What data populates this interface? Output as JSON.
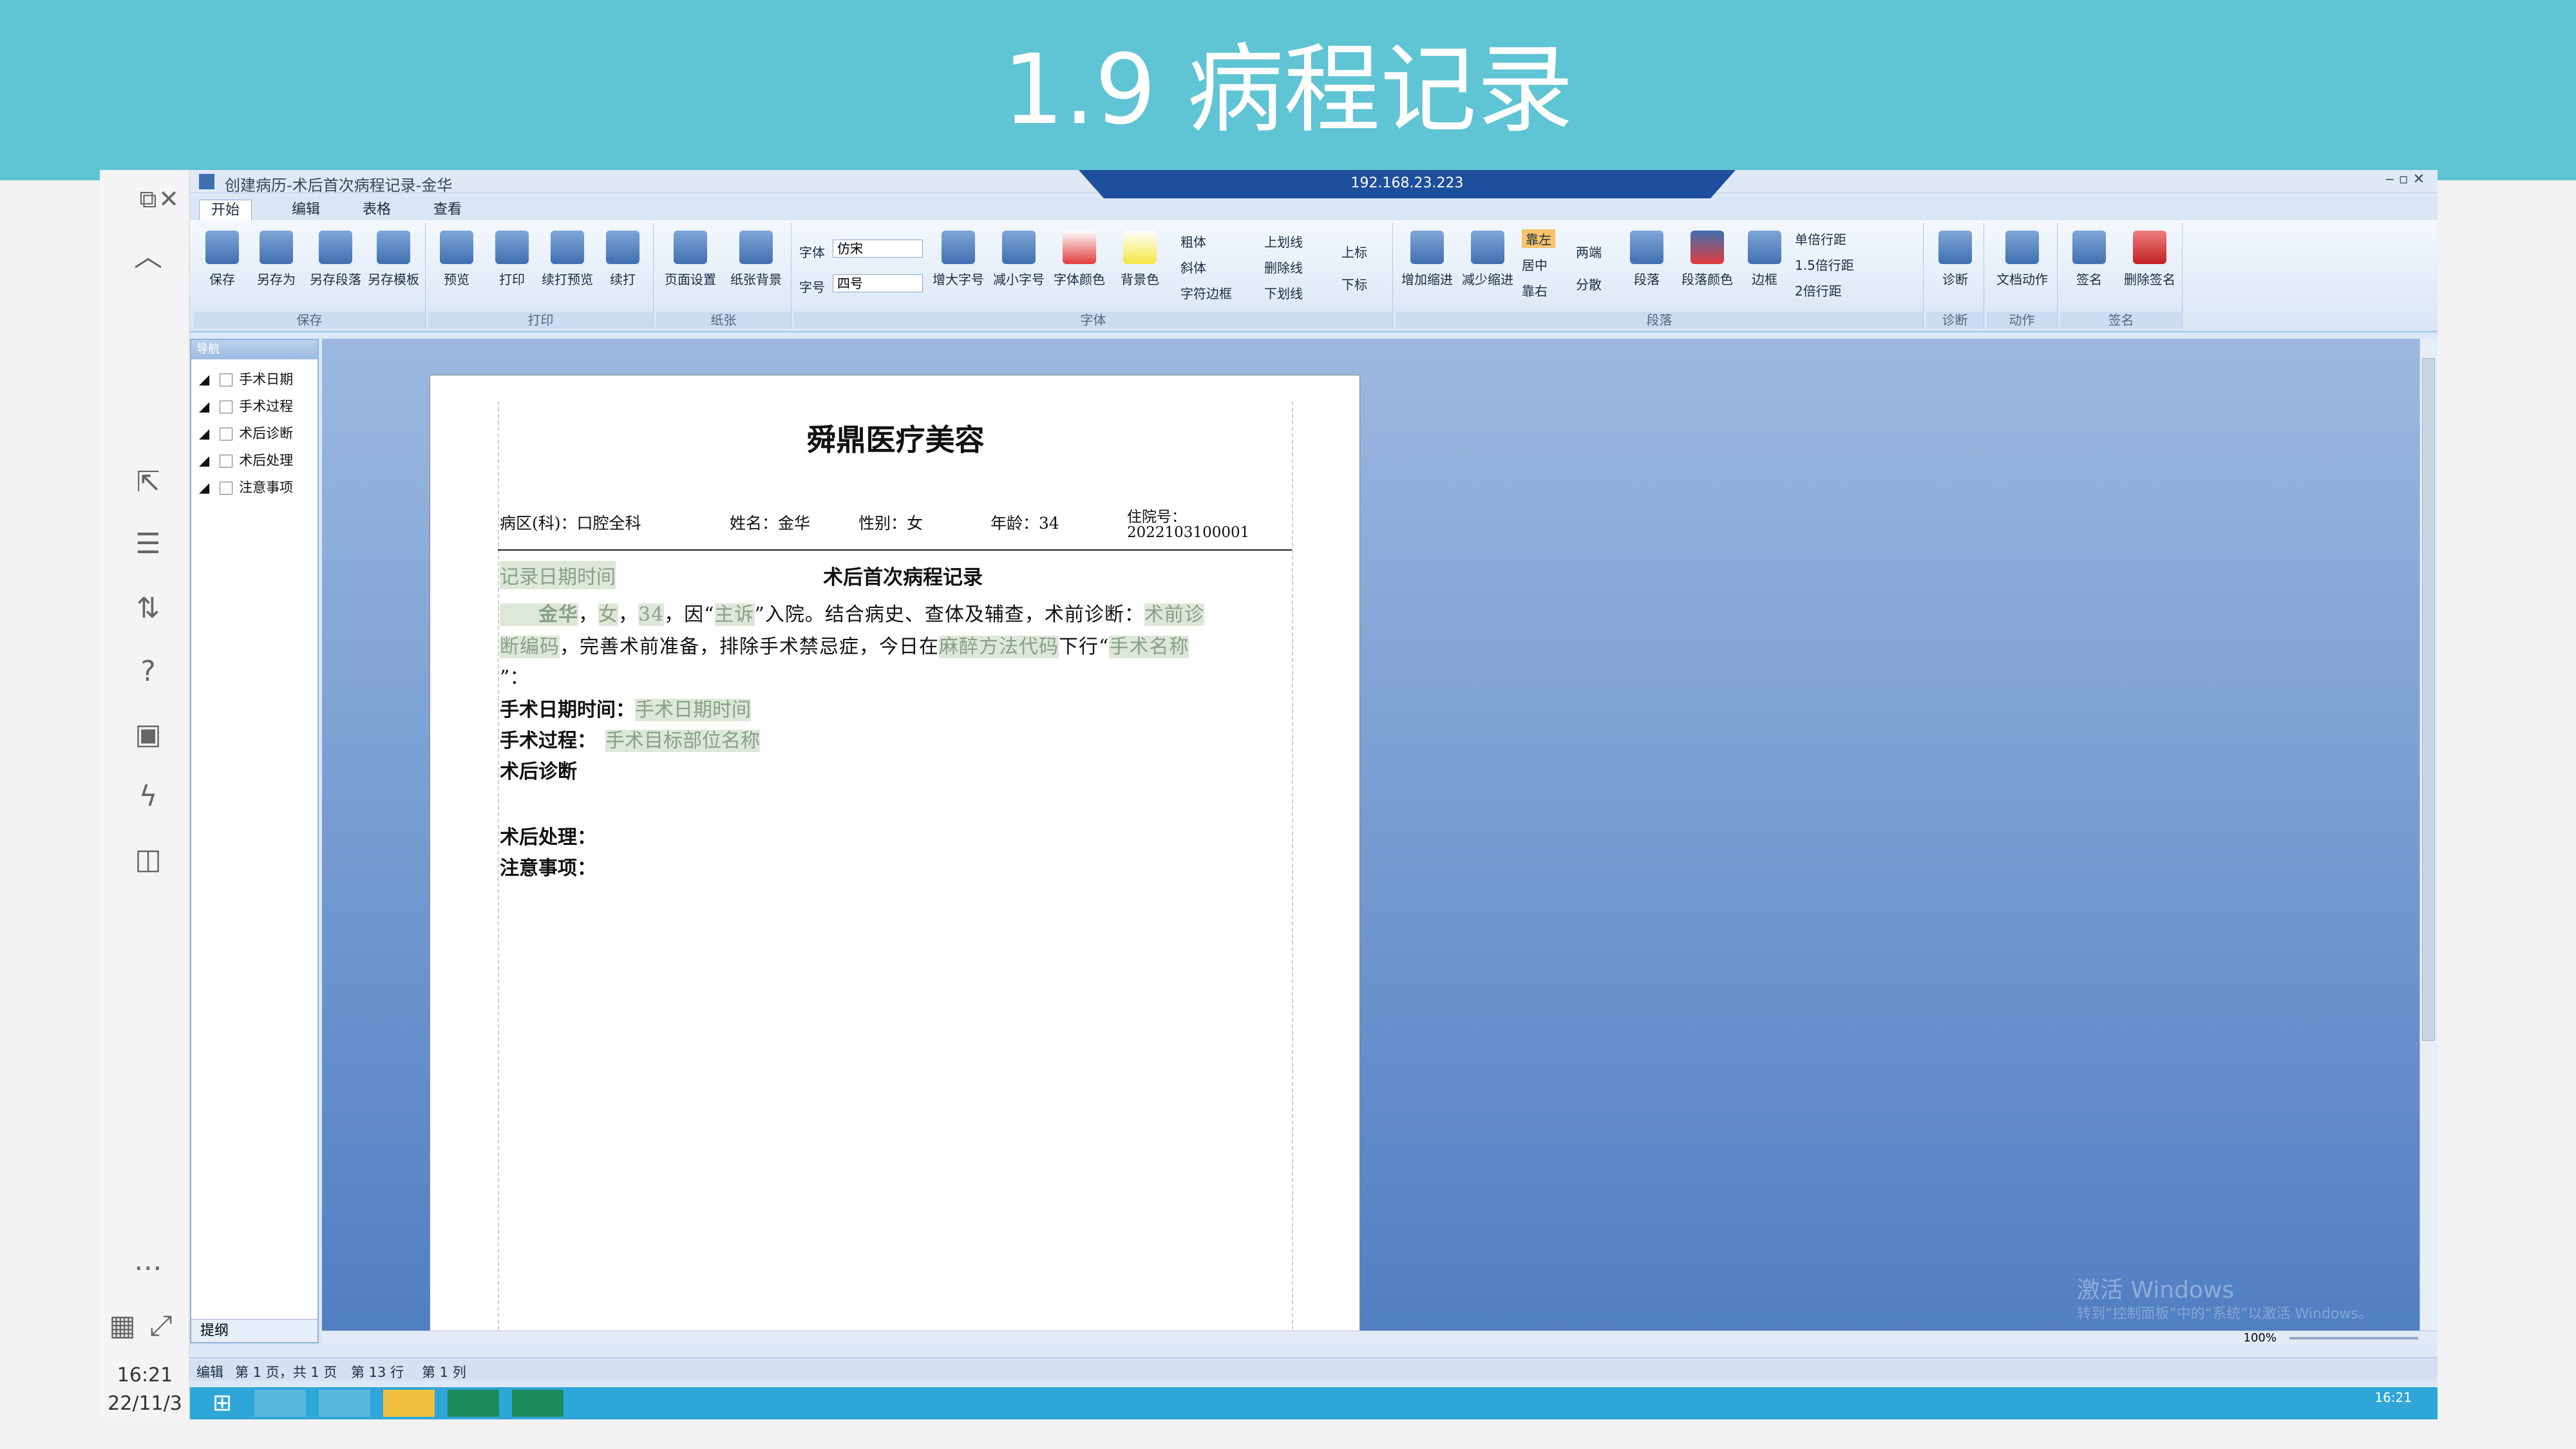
{
  "slide": {
    "title": "1.9 病程记录"
  },
  "window": {
    "title": "创建病历-术后首次病程记录-金华",
    "remote_ip": "192.168.23.223"
  },
  "ribbon_tabs": [
    "开始",
    "编辑",
    "表格",
    "查看"
  ],
  "ribbon": {
    "save_group": {
      "label": "保存",
      "buttons": [
        "保存",
        "另存为",
        "另存段落",
        "另存模板"
      ]
    },
    "print_group": {
      "label": "打印",
      "buttons": [
        "预览",
        "打印",
        "续打预览",
        "续打"
      ]
    },
    "paper_group": {
      "label": "纸张",
      "buttons": [
        "页面设置",
        "纸张背景"
      ]
    },
    "font_group": {
      "label": "字体",
      "font_label": "字体",
      "font_value": "仿宋",
      "size_label": "字号",
      "size_value": "四号",
      "buttons": [
        "增大字号",
        "减小字号",
        "字体颜色",
        "背景色"
      ],
      "styles": [
        "粗体",
        "斜体",
        "字符边框",
        "上划线",
        "删除线",
        "下划线",
        "上标",
        "下标"
      ]
    },
    "para_group": {
      "label": "段落",
      "buttons": [
        "增加缩进",
        "减少缩进",
        "段落",
        "段落颜色",
        "边框"
      ],
      "align": [
        "靠左",
        "居中",
        "靠右",
        "两端",
        "分散"
      ],
      "spacing": [
        "单倍行距",
        "1.5倍行距",
        "2倍行距"
      ]
    },
    "diag_group": {
      "label": "诊断",
      "button": "诊断"
    },
    "action_group": {
      "label": "动作",
      "button": "文档动作"
    },
    "sign_group": {
      "label": "签名",
      "buttons": [
        "签名",
        "删除签名"
      ]
    }
  },
  "nav": {
    "header": "导航",
    "items": [
      "手术日期",
      "手术过程",
      "术后诊断",
      "术后处理",
      "注意事项"
    ],
    "footer": "提纲"
  },
  "doc": {
    "org": "舜鼎医疗美容",
    "header": {
      "dept": "病区(科)：口腔全科",
      "name": "姓名：金华",
      "sex": "性别：女",
      "age": "年龄：34",
      "admit_label": "住院号：",
      "admit_no": "2022103100001"
    },
    "record_time_field": "记录日期时间",
    "record_title": "术后首次病程记录",
    "p1": {
      "name": "金华",
      "sep1": "，",
      "sex": "女",
      "sep2": "，",
      "age": "34",
      "t1": "，因“",
      "complaint": "主诉",
      "t2": "”入院。结合病史、查体及辅查，术前诊断：",
      "preop_dx": "术前诊"
    },
    "p2": {
      "preop_dx2": "断编码",
      "t1": "，完善术前准备，排除手术禁忌症，今日在",
      "anes": "麻醉方法代码",
      "t2": "下行“",
      "op": "手术名称"
    },
    "p3": "”：",
    "op_date_label": "手术日期时间：",
    "op_date_field": "手术日期时间",
    "op_proc_label": "手术过程：",
    "op_proc_field": "手术目标部位名称",
    "postop_dx": "术后诊断",
    "postop_treat": "术后处理：",
    "notes": "注意事项："
  },
  "status": {
    "mode": "编辑",
    "page": "第 1 页，共 1 页",
    "line": "第 13 行",
    "col": "第 1 列",
    "zoom": "100%"
  },
  "watermark": {
    "line1": "激活 Windows",
    "line2": "转到“控制面板”中的“系统”以激活 Windows。"
  },
  "clock": {
    "time": "16:21",
    "date": "22/11/3",
    "tray_time": "16:21"
  }
}
